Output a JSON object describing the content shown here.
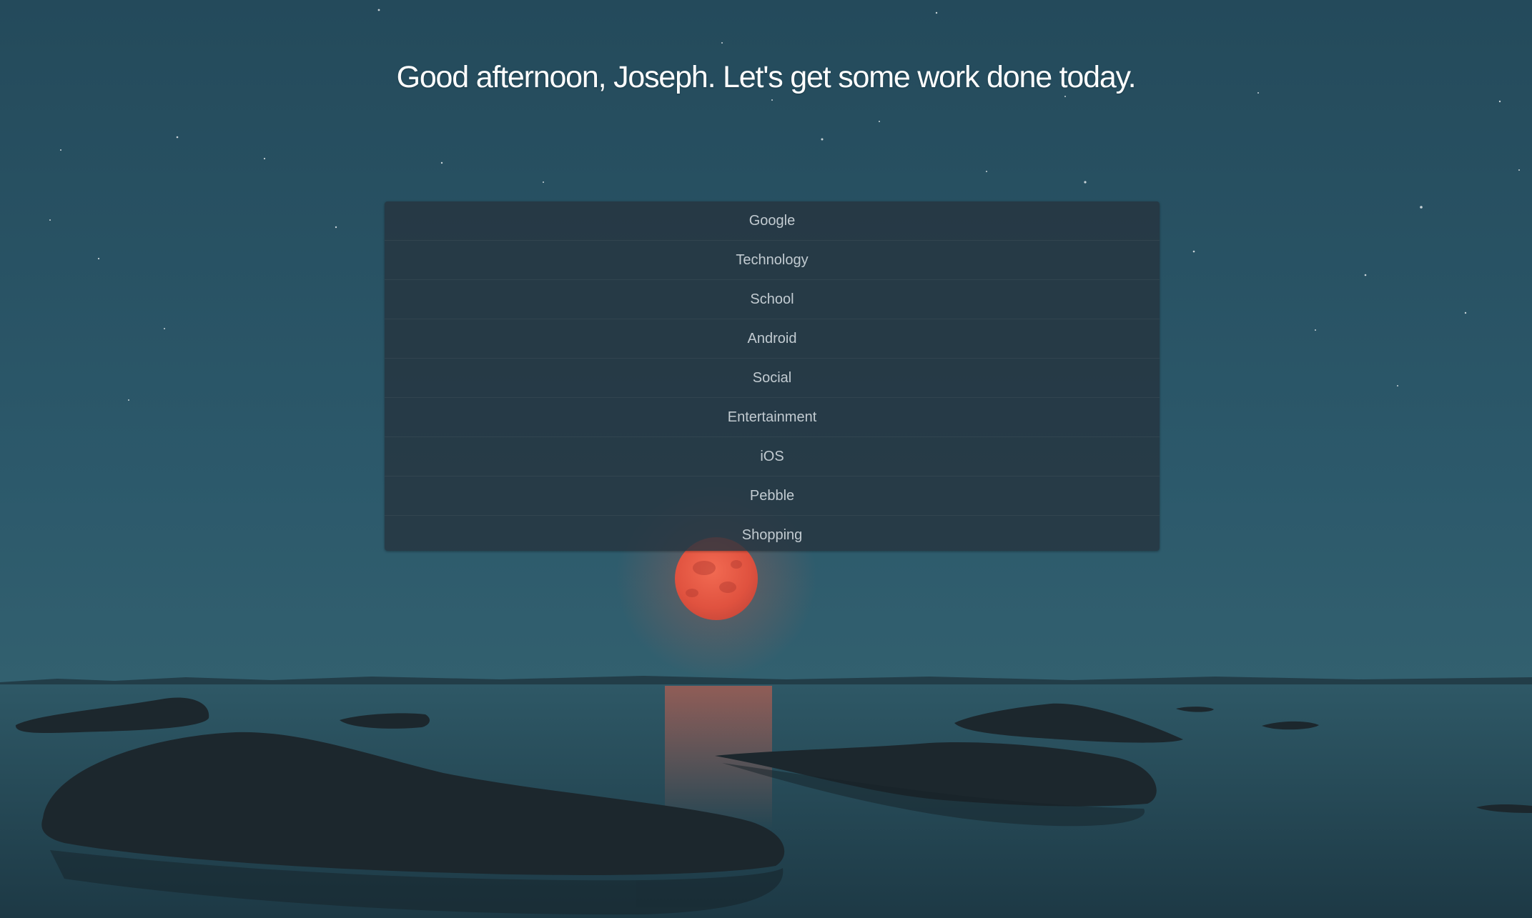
{
  "greeting": "Good afternoon, Joseph. Let's get some work done today.",
  "menu": {
    "items": [
      {
        "label": "Google"
      },
      {
        "label": "Technology"
      },
      {
        "label": "School"
      },
      {
        "label": "Android"
      },
      {
        "label": "Social"
      },
      {
        "label": "Entertainment"
      },
      {
        "label": "iOS"
      },
      {
        "label": "Pebble"
      },
      {
        "label": "Shopping"
      }
    ]
  },
  "colors": {
    "sky_top": "#244b5c",
    "sky_horizon": "#2f5d6e",
    "water": "#2a4f5c",
    "moon": "#e85a45",
    "rocks": "#1e2a30",
    "menu_bg": "#263440",
    "menu_text": "#c2cbd1",
    "greeting_text": "#ffffff"
  }
}
